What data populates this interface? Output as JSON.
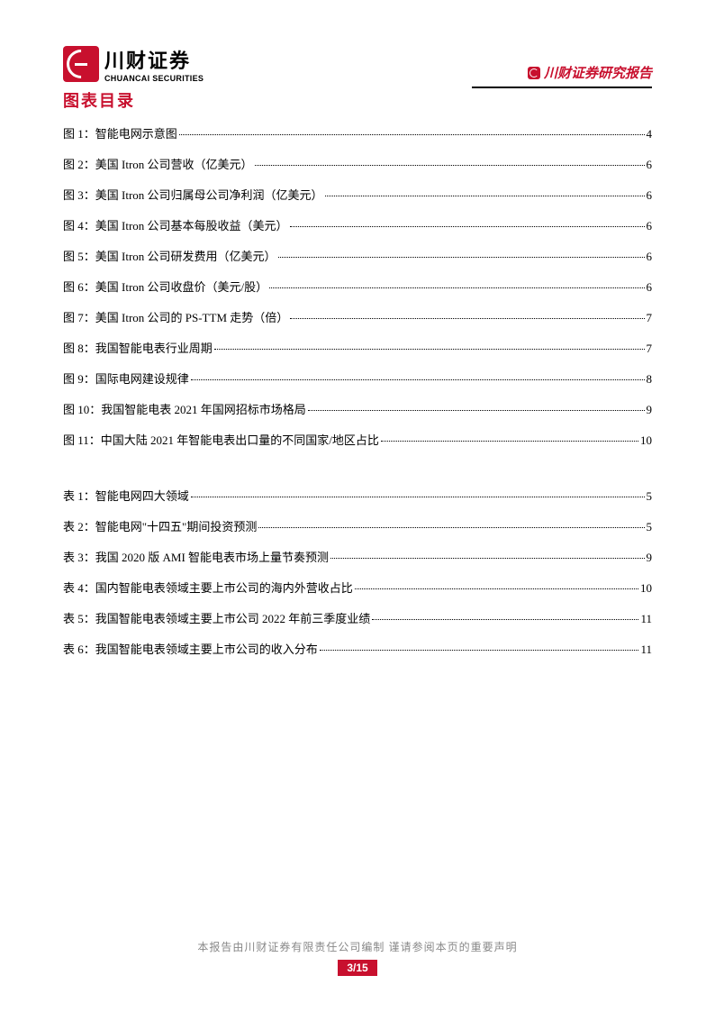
{
  "header": {
    "logo_cn": "川财证券",
    "logo_en": "CHUANCAI SECURITIES",
    "report_label": "川财证券研究报告"
  },
  "toc": {
    "title": "图表目录",
    "figures": [
      {
        "label": "图 1：智能电网示意图",
        "page": "4"
      },
      {
        "label": "图 2：美国 Itron 公司营收（亿美元）",
        "page": "6"
      },
      {
        "label": "图 3：美国 Itron 公司归属母公司净利润（亿美元）",
        "page": "6"
      },
      {
        "label": "图 4：美国 Itron 公司基本每股收益（美元）",
        "page": "6"
      },
      {
        "label": "图 5：美国 Itron 公司研发费用（亿美元）",
        "page": "6"
      },
      {
        "label": "图 6：美国 Itron 公司收盘价（美元/股）",
        "page": "6"
      },
      {
        "label": "图 7：美国 Itron 公司的 PS-TTM 走势（倍）",
        "page": "7"
      },
      {
        "label": "图 8：我国智能电表行业周期",
        "page": "7"
      },
      {
        "label": "图 9：国际电网建设规律",
        "page": "8"
      },
      {
        "label": "图 10：我国智能电表 2021 年国网招标市场格局",
        "page": "9"
      },
      {
        "label": "图 11：中国大陆 2021 年智能电表出口量的不同国家/地区占比",
        "page": "10"
      }
    ],
    "tables": [
      {
        "label": "表 1：智能电网四大领域",
        "page": "5"
      },
      {
        "label": "表 2：智能电网\"十四五\"期间投资预测",
        "page": "5"
      },
      {
        "label": "表 3：我国 2020 版 AMI 智能电表市场上量节奏预测",
        "page": "9"
      },
      {
        "label": "表 4：国内智能电表领域主要上市公司的海内外营收占比",
        "page": "10"
      },
      {
        "label": "表 5：我国智能电表领域主要上市公司 2022 年前三季度业绩",
        "page": "11"
      },
      {
        "label": "表 6：我国智能电表领域主要上市公司的收入分布",
        "page": "11"
      }
    ]
  },
  "footer": {
    "disclaimer": "本报告由川财证券有限责任公司编制  谨请参阅本页的重要声明",
    "page_info": "3/15"
  }
}
